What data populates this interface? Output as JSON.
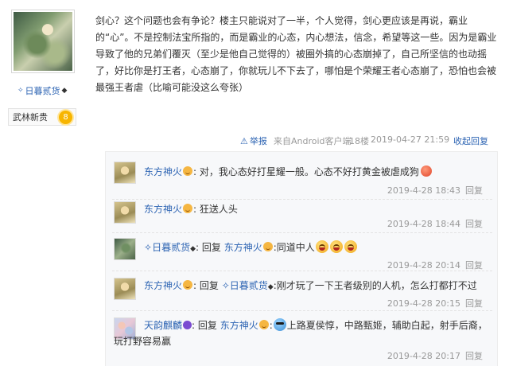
{
  "author": {
    "name": "日暮贰货",
    "rank_title": "武林新贵",
    "rank_level": "8"
  },
  "post": {
    "body": "剑心？这个问题也会有争论？楼主只能说对了一半，个人觉得，剑心更应该是再说，霸业的“心”。不是控制法宝所指的，而是霸业的心态，内心想法，信念，希望等这一些。因为是霸业导致了他的兄弟们覆灭（至少是他自己觉得的）被圈外搞的心态崩掉了，自己所坚信的也动摇了，好比你是打王者，心态崩了，你就玩儿不下去了，哪怕是个荣耀王者心态崩了，恐怕也会被最强王者虐（比喻可能没这么夸张）",
    "meta": {
      "report": "举报",
      "source": "来自Android客户端",
      "floor": "18楼",
      "time": "2019-04-27 21:59",
      "collapse": "收起回复"
    }
  },
  "replies": [
    {
      "user": "东方神火",
      "prefix": "",
      "target": "",
      "text": ": 对，我心态好打星耀一般。心态不好打黄金被虐成狗",
      "time": "2019-4-28 18:43",
      "reply_label": "回复"
    },
    {
      "user": "东方神火",
      "prefix": "",
      "target": "",
      "text": ": 狂送人头",
      "time": "2019-4-28 18:44",
      "reply_label": "回复"
    },
    {
      "user": "日暮贰货",
      "prefix": ": 回复",
      "target": "东方神火",
      "text": ":同道中人",
      "time": "2019-4-28 20:14",
      "reply_label": "回复"
    },
    {
      "user": "东方神火",
      "prefix": ": 回复",
      "target": "日暮贰货",
      "text": ":刚才玩了一下王者级别的人机，怎么打都打不过",
      "time": "2019-4-28 20:15",
      "reply_label": "回复"
    },
    {
      "user": "天韵麒麟",
      "prefix": ": 回复",
      "target": "东方神火",
      "text": "上路夏侯惇，中路甄姬，辅助白起，射手后裔，玩打野容易赢",
      "time": "2019-4-28 20:17",
      "reply_label": "回复"
    }
  ]
}
